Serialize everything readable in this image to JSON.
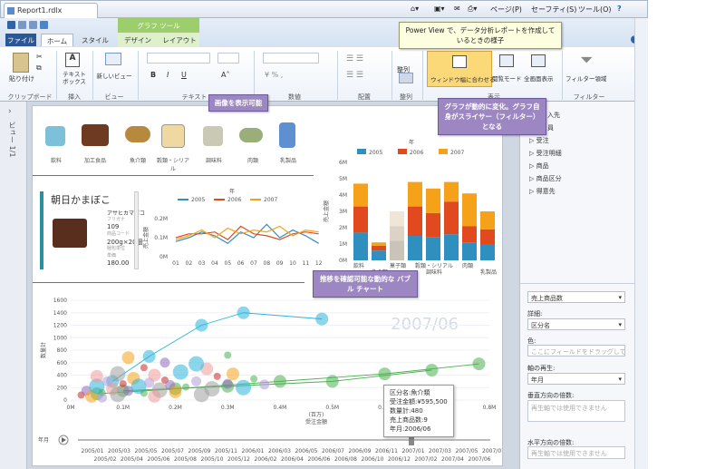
{
  "browser": {
    "tab_title": "Report1.rdlx",
    "toolbar": {
      "page": "ページ(P)",
      "safety": "セーフティ(S)",
      "tools": "ツール(O)",
      "help": "?"
    }
  },
  "ribbon": {
    "file": "ファイル",
    "tabs": [
      "ホーム",
      "スタイル",
      "デザイン",
      "レイアウト"
    ],
    "context_group": "グラフ ツール",
    "groups": {
      "clipboard": "クリップボード",
      "insert": "挿入",
      "view": "ビュー",
      "text": "テキスト",
      "number": "数値",
      "arrange": "配置",
      "align": "整列",
      "display": "表示",
      "filter": "フィルター"
    },
    "buttons": {
      "paste": "貼り付け",
      "textbox": "テキスト ボックス",
      "new_view": "新しいビュー",
      "align": "整列",
      "fit_window": "ウィンドウ幅に合わせる",
      "reading_mode": "閲覧モード",
      "fullscreen": "全画面表示",
      "filter_area": "フィルター領域"
    }
  },
  "callouts": {
    "powerview": "Power View で、データ分析レポートを作成しているときの様子",
    "image": "画像を表示可能",
    "graph": "グラフが動的に変化。グラフ自身がスライサー（フィルター）となる",
    "bubble": "推移を確認可能な動的な バブル チャート"
  },
  "left_strip": "ビュー 1/1",
  "categories": [
    "飲料",
    "加工食品",
    "魚介類",
    "穀類・シリアル",
    "調味料",
    "肉類",
    "乳製品"
  ],
  "product_card": {
    "name": "朝日かまぼこ",
    "vendor": "アサヒカマボコ",
    "sub": "フリガナ",
    "id": "109",
    "id_lbl": "商品コード",
    "pack": "200g×20個",
    "pack_lbl": "梱包単位",
    "price": "180.00",
    "price_lbl": "単価"
  },
  "line_chart": {
    "title": "年",
    "legend": [
      "2005",
      "2006",
      "2007"
    ],
    "colors": [
      "#2f8fbf",
      "#e04a1e",
      "#f5a21a"
    ],
    "x": [
      "01",
      "02",
      "03",
      "04",
      "05",
      "06",
      "07",
      "08",
      "09",
      "10",
      "11",
      "12"
    ],
    "yticks": [
      "0M",
      "0.1M",
      "0.2M"
    ],
    "ylabel": "売上金額"
  },
  "bar_chart": {
    "title": "年",
    "legend": [
      "2005",
      "2006",
      "2007"
    ],
    "colors": [
      "#2f8fbf",
      "#e04a1e",
      "#f5a21a"
    ],
    "yticks": [
      "0M",
      "1M",
      "2M",
      "3M",
      "4M",
      "5M",
      "6M"
    ],
    "ylabel": "売上金額",
    "xlabels_top": [
      "飲料",
      "菓子類",
      "穀類・シリアル",
      "肉類"
    ],
    "xlabels_bottom": [
      "魚介類",
      "調味料",
      "乳製品"
    ]
  },
  "bubble_chart": {
    "watermark": "2007/06",
    "yticks": [
      "0",
      "200",
      "400",
      "600",
      "800",
      "1000",
      "1200",
      "1400",
      "1600"
    ],
    "xticks": [
      "0M",
      "0.1M",
      "0.2M",
      "0.3M",
      "0.4M",
      "0.5M",
      "0.6M",
      "0.7M",
      "0.8M"
    ],
    "xlabel": "受注金額",
    "xlabel_sub": "(百万)",
    "ylabel": "数量計",
    "play_label": "年月",
    "timeline_top": [
      "2005/01",
      "2005/03",
      "2005/05",
      "2005/07",
      "2005/09",
      "2005/11",
      "2006/01",
      "2006/03",
      "2006/05",
      "2006/07",
      "2006/09",
      "2006/11",
      "2007/01",
      "2007/03",
      "2007/05",
      "2007/07"
    ],
    "timeline_bottom": [
      "2005/02",
      "2005/04",
      "2005/06",
      "2005/08",
      "2005/10",
      "2005/12",
      "2006/02",
      "2006/04",
      "2006/06",
      "2006/08",
      "2006/10",
      "2006/12",
      "2007/02",
      "2007/04",
      "2007/06"
    ],
    "tooltip": [
      "区分名:魚介類",
      "受注金額:¥595,500",
      "数量計:480",
      "売上商品数:9",
      "年月:2006/06"
    ]
  },
  "right_panel": {
    "tree": [
      "入先",
      "員",
      "受注",
      "受注明細",
      "商品",
      "商品区分",
      "得意先"
    ],
    "size_field": "売上商品数",
    "detail_label": "詳細:",
    "detail_value": "区分名",
    "color_label": "色:",
    "color_placeholder": "ここにフィールドをドラッグしてくだ",
    "play_label": "軸の再生:",
    "play_value": "年月",
    "vmult_label": "垂直方向の倍数:",
    "vmult_placeholder": "再生軸では使用できません",
    "hmult_label": "水平方向の倍数:",
    "hmult_placeholder": "再生軸では使用できません"
  }
}
